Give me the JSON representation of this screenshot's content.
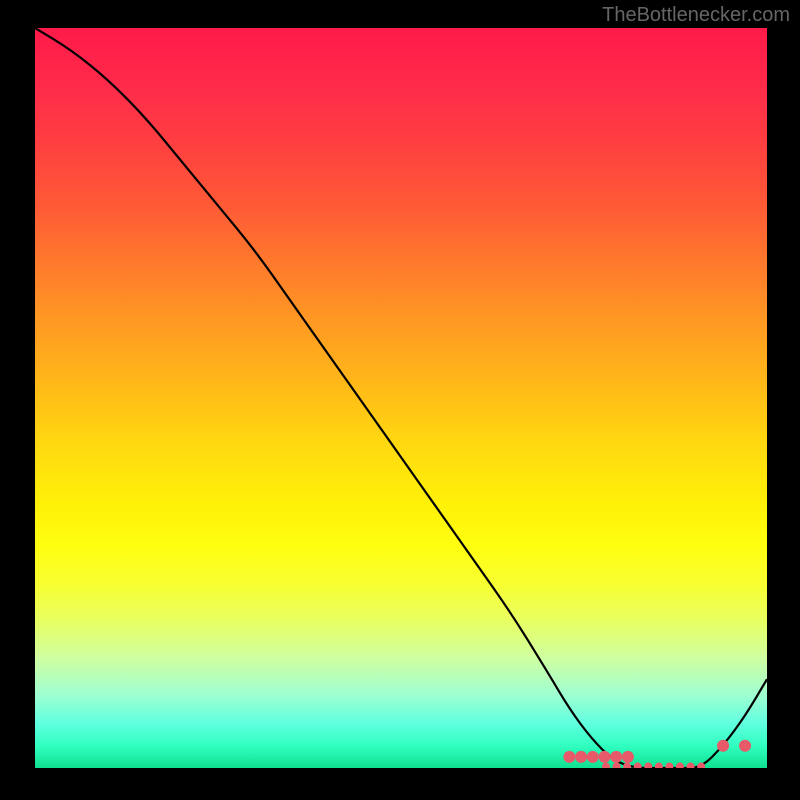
{
  "watermark": "TheBottlenecker.com",
  "chart_data": {
    "type": "line",
    "title": "",
    "xlabel": "",
    "ylabel": "",
    "xlim": [
      0,
      100
    ],
    "ylim": [
      0,
      100
    ],
    "series": [
      {
        "name": "curve",
        "x": [
          0,
          5,
          10,
          15,
          20,
          25,
          30,
          35,
          40,
          45,
          50,
          55,
          60,
          65,
          70,
          73,
          76,
          79,
          82,
          85,
          88,
          91,
          94,
          97,
          100
        ],
        "values": [
          100,
          97,
          93,
          88,
          82,
          76,
          70,
          63,
          56,
          49,
          42,
          35,
          28,
          21,
          13,
          8,
          4,
          1,
          0,
          0,
          0,
          0,
          3,
          7,
          12
        ]
      }
    ],
    "markers": [
      {
        "name": "left-cluster",
        "x_range": [
          73,
          81
        ],
        "y": 1.5,
        "count": 6
      },
      {
        "name": "bottom-cluster",
        "x_range": [
          78,
          91
        ],
        "y": 0.2,
        "count": 10
      },
      {
        "name": "right-pair",
        "x_range": [
          94,
          97
        ],
        "y": 3,
        "count": 2
      }
    ],
    "gradient_stops": [
      {
        "pos": 0,
        "color": "#ff1a4a"
      },
      {
        "pos": 50,
        "color": "#ffd810"
      },
      {
        "pos": 75,
        "color": "#f8ff30"
      },
      {
        "pos": 100,
        "color": "#10e090"
      }
    ]
  }
}
